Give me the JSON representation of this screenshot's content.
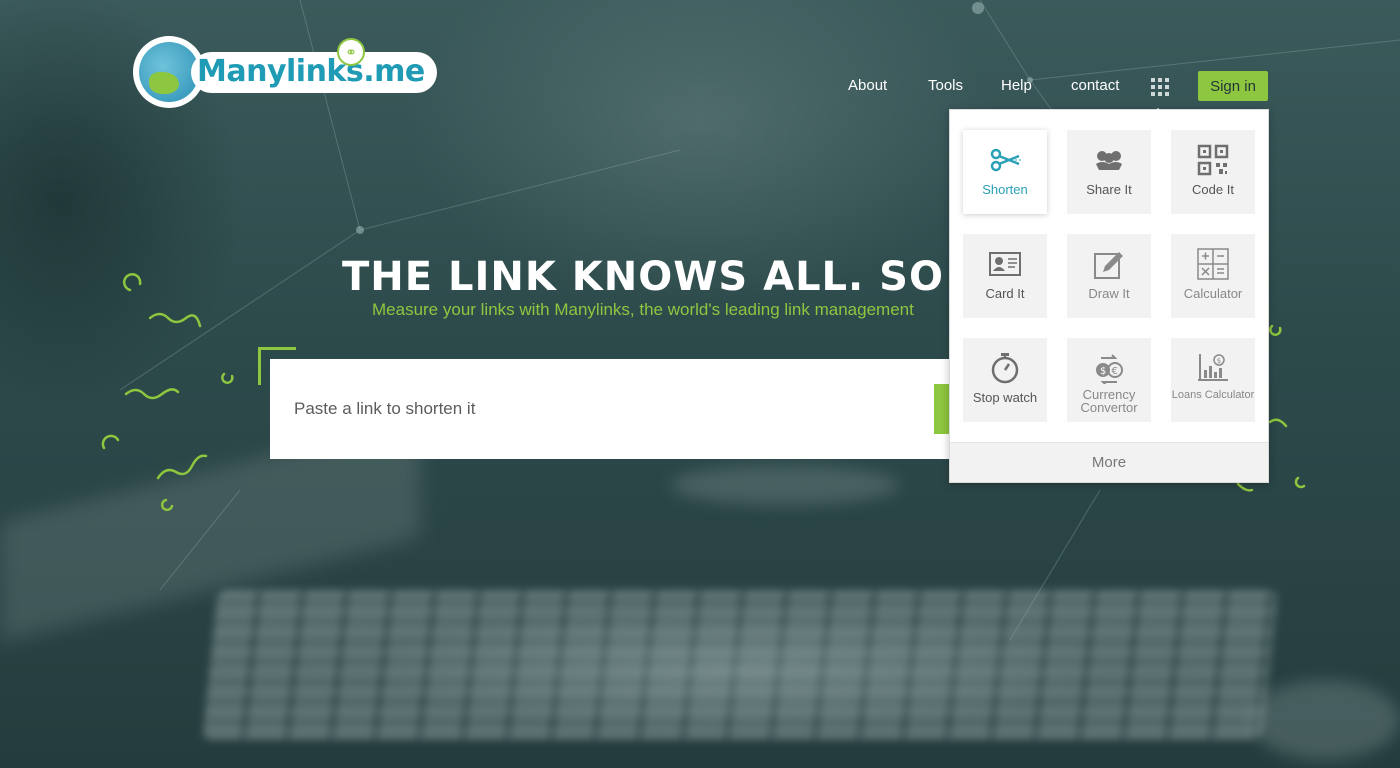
{
  "brand": {
    "name": "Manylinks.me"
  },
  "nav": {
    "about": "About",
    "tools": "Tools",
    "help": "Help",
    "contact": "contact",
    "signin": "Sign in"
  },
  "hero": {
    "title": "THE LINK KNOWS ALL. SO CAN",
    "subtitle": "Measure your links with Manylinks, the world's leading link management",
    "placeholder": "Paste a link to shorten it"
  },
  "apps_menu": {
    "tiles": [
      {
        "label": "Shorten",
        "icon": "scissors-icon",
        "active": true
      },
      {
        "label": "Share It",
        "icon": "people-icon"
      },
      {
        "label": "Code It",
        "icon": "qr-code-icon"
      },
      {
        "label": "Card It",
        "icon": "id-card-icon"
      },
      {
        "label": "Draw It",
        "icon": "pencil-drawing-icon"
      },
      {
        "label": "Calculator",
        "icon": "calculator-icon"
      },
      {
        "label": "Stop watch",
        "icon": "stopwatch-icon"
      },
      {
        "label": "Currency Convertor",
        "icon": "currency-exchange-icon"
      },
      {
        "label": "Loans Calculator",
        "icon": "loan-chart-icon"
      }
    ],
    "more": "More"
  },
  "colors": {
    "accent": "#8dc63f",
    "brand": "#1f9bb5",
    "active_tile_text": "#2aa1b7"
  }
}
